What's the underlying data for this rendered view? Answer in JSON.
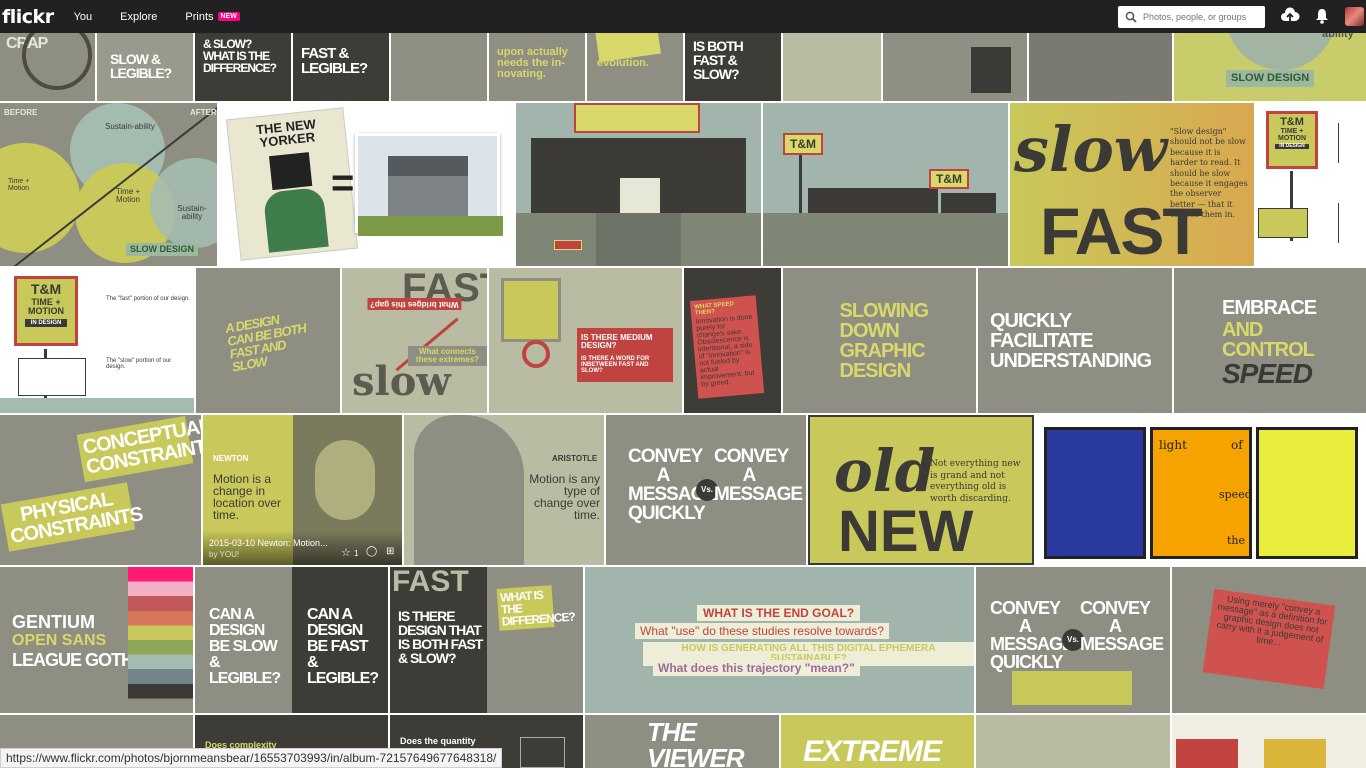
{
  "header": {
    "logo": "flickr",
    "nav": [
      {
        "label": "You"
      },
      {
        "label": "Explore"
      },
      {
        "label": "Prints",
        "badge": "NEW"
      }
    ],
    "search_placeholder": "Photos, people, or groups",
    "icons": [
      "upload-icon",
      "bell-icon",
      "avatar"
    ]
  },
  "tiles": {
    "r1": {
      "a": "CRAP",
      "b": "SLOW & LEGIBLE?",
      "c": "& SLOW? WHAT IS THE DIFFERENCE?",
      "d": "FAST & LEGIBLE?",
      "f": "upon actually needs the in-novating.",
      "g": "evolution.",
      "h": "IS BOTH FAST & SLOW?",
      "l": "ability",
      "m": "SLOW DESIGN"
    },
    "r2": {
      "a_before": "BEFORE",
      "a_after": "AFTER",
      "a_sust1": "Sustain-ability",
      "a_tm1": "Time + Motion",
      "a_tm2": "Time + Motion",
      "a_sust2": "Sustain-ability",
      "a_slow": "SLOW DESIGN",
      "b_title": "THE NEW YORKER",
      "c_sign": "T&M",
      "d_sign1": "T&M",
      "d_sign2": "T&M",
      "e_text": "\"Slow design\" should not be slow because it is harder to read. It should be slow because it engages the observer better — that it entices them in.",
      "e_slow": "slow",
      "e_fast": "FAST",
      "f_tm": "T&M",
      "f_sub": "TIME + MOTION",
      "f_in": "IN DESIGN"
    },
    "r3": {
      "a_tm": "T&M",
      "a_sub": "TIME + MOTION",
      "a_in": "IN DESIGN",
      "a_p1": "The \"fast\" portion of our design.",
      "a_p2": "The \"slow\" portion of our design.",
      "b": "A DESIGN CAN BE BOTH FAST AND SLOW",
      "c_q1": "What bridges this gap?",
      "c_q2": "What connects these extremes?",
      "c_fast": "FAST",
      "c_slow": "slow",
      "d_q1": "IS THERE MEDIUM DESIGN?",
      "d_q2": "IS THERE A WORD FOR INBETWEEN FAST AND SLOW?",
      "e_card": "Innovation is done purely for change's sake. Obsolescence is intentional, a side of \"innovation\" is not fueled by actual improvement, but by greed.",
      "e_head": "WHAT SPEED THEN?",
      "f": "SLOWING DOWN GRAPHIC DESIGN",
      "g": "QUICKLY FACILITATE UNDERSTANDING",
      "h1": "EMBRACE",
      "h2": "AND",
      "h3": "CONTROL",
      "h4": "SPEED"
    },
    "r4": {
      "a1": "CONCEPTUAL CONSTRAINTS",
      "a2": "PHYSICAL CONSTRAINTS",
      "b_name": "NEWTON",
      "b_quote": "Motion is a change in location over time.",
      "b_date": "2015-03-10 Newton: Motion...",
      "b_by": "by YOU!",
      "b_fav": "1",
      "c_name": "ARISTOTLE",
      "c_quote": "Motion is any type of change over time.",
      "d_left": "CONVEY A MESSAGE QUICKLY",
      "d_vs": "Vs.",
      "d_right": "CONVEY A MESSAGE",
      "e_text": "Not everything new is grand and not everything old is worth discarding.",
      "e_old": "old",
      "e_new": "NEW",
      "f_light": "light",
      "f_of": "of",
      "f_speed": "speed",
      "f_the": "the"
    },
    "r5": {
      "a1": "GENTIUM",
      "a2": "OPEN SANS",
      "a3": "LEAGUE GOTHIC",
      "b1": "CAN A DESIGN BE SLOW & LEGIBLE?",
      "b2": "CAN A DESIGN BE FAST & LEGIBLE?",
      "c1": "IS THERE DESIGN THAT IS BOTH FAST & SLOW?",
      "c2": "WHAT IS THE DIFFERENCE?",
      "c_fast": "FAST",
      "d1": "WHAT IS THE END GOAL?",
      "d2": "What \"use\" do these studies resolve towards?",
      "d3": "HOW IS GENERATING ALL THIS DIGITAL EPHEMERA SUSTAINABLE?",
      "d4": "What does this trajectory \"mean?\"",
      "e_left": "CONVEY A MESSAGE QUICKLY",
      "e_vs": "Vs.",
      "e_right": "CONVEY A MESSAGE",
      "f_card": "Using merely \"convey a message\" as a definition for graphic design does not carry with it a judgement of time..."
    },
    "r6": {
      "b": "Does complexity",
      "c": "Does the quantity",
      "d": "THE VIEWER",
      "e": "EXTREME"
    }
  },
  "colors": {
    "header_bg": "#212124",
    "accent_pink": "#ff0084",
    "olive": "#c8c95a",
    "gray_tile": "#8e8e83",
    "dark": "#3b3a36",
    "red": "#d0524f"
  },
  "status_url": "https://www.flickr.com/photos/bjornmeansbear/16553703993/in/album-72157649677648318/"
}
